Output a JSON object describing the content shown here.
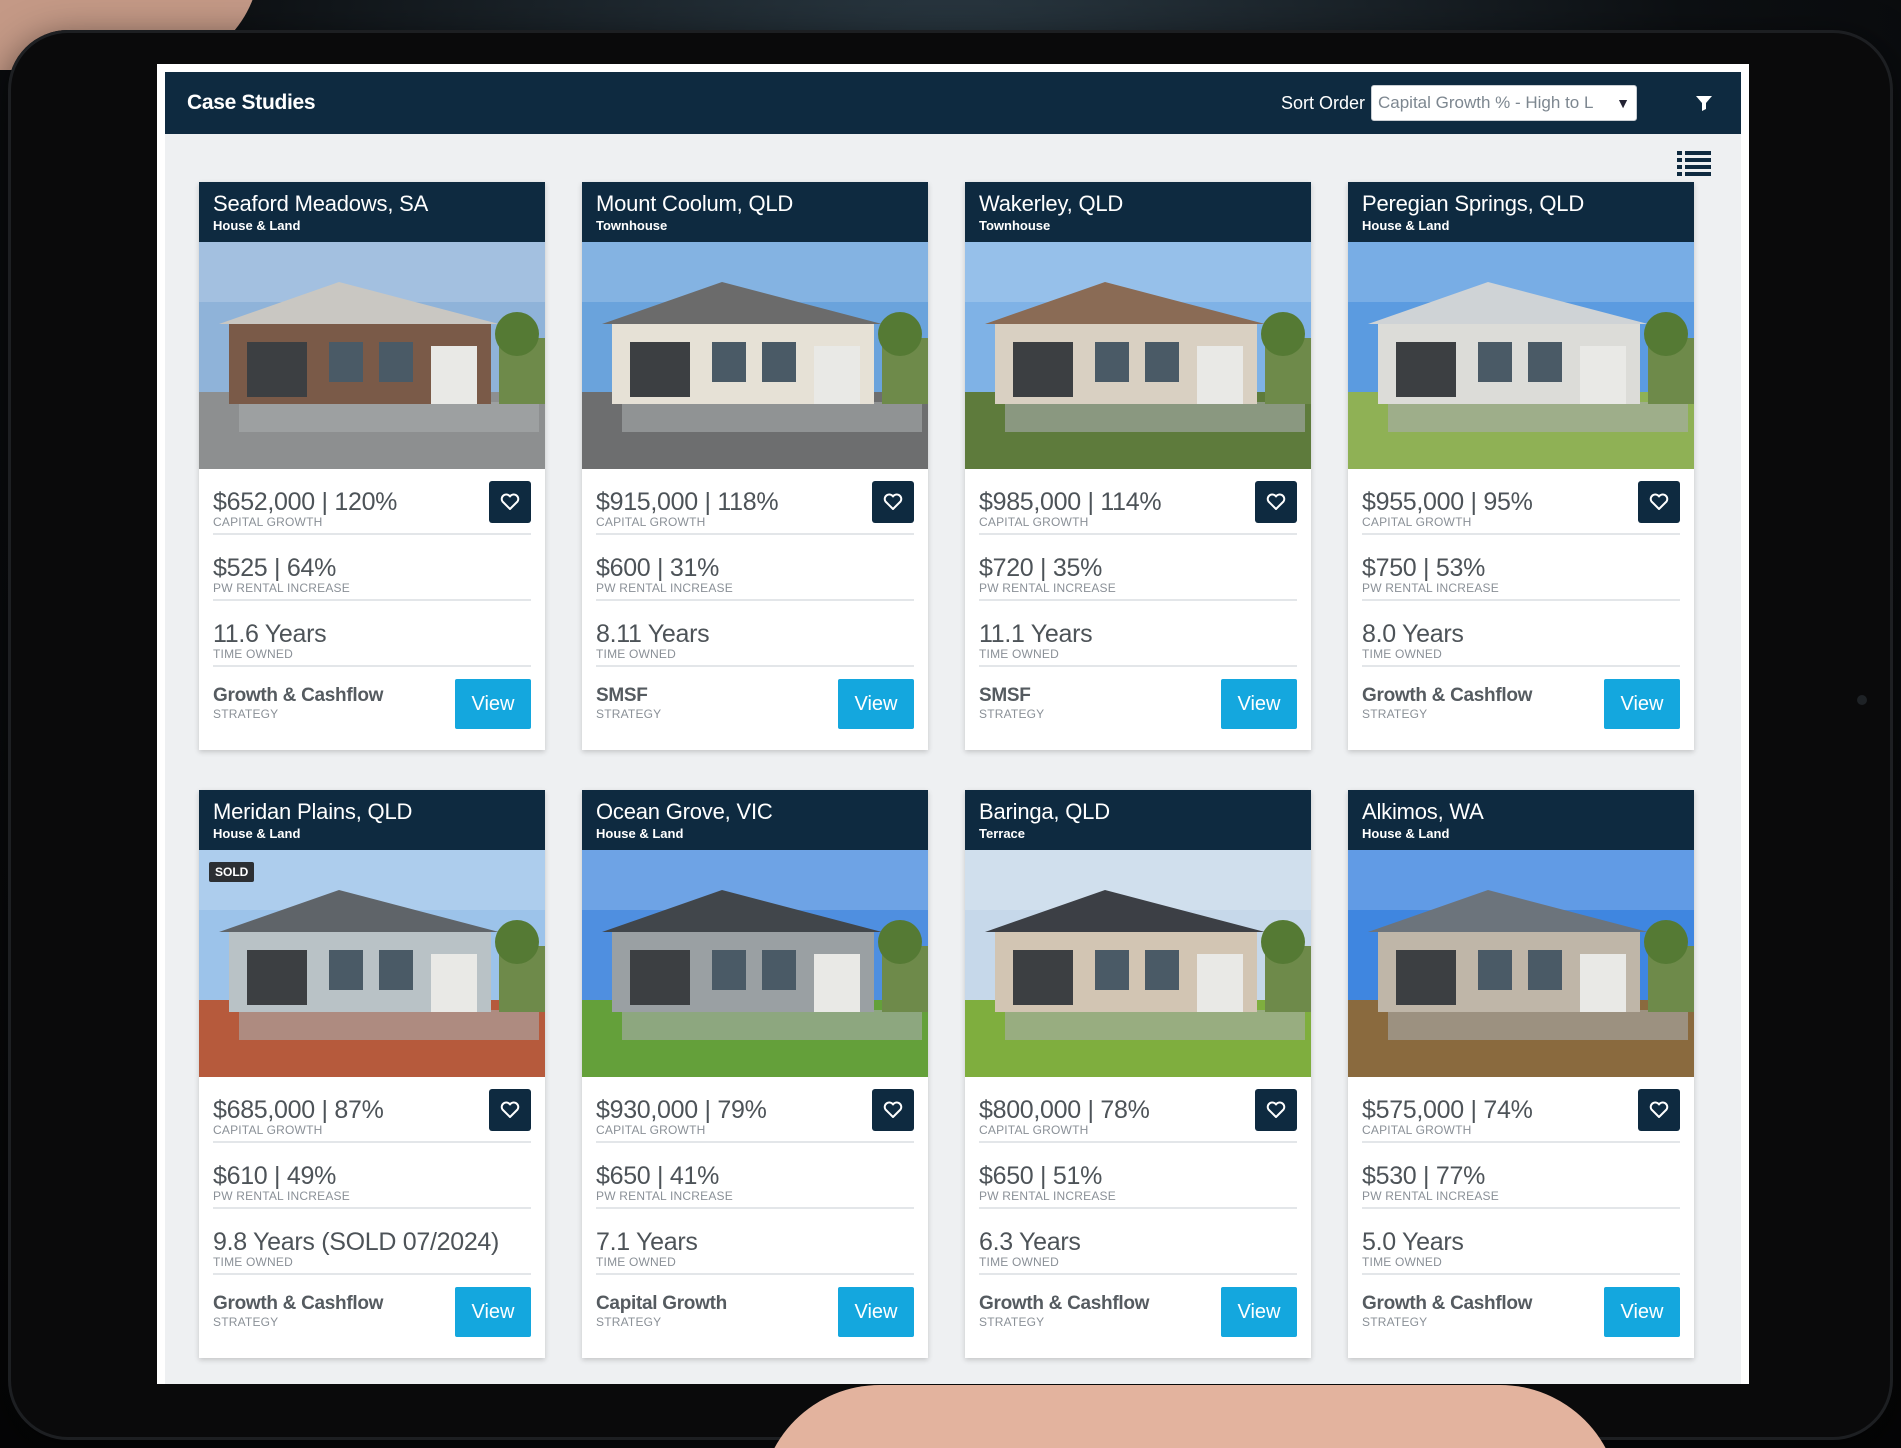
{
  "app": {
    "title": "Case Studies",
    "sort_label": "Sort Order",
    "sort_value": "Capital Growth % - High to L",
    "filter_icon": "filter-icon",
    "list_icon": "list-view-icon"
  },
  "labels": {
    "capital_growth": "CAPITAL GROWTH",
    "rental": "PW RENTAL INCREASE",
    "time": "TIME OWNED",
    "strategy": "STRATEGY",
    "view": "View",
    "sold": "SOLD"
  },
  "colors": {
    "header_navy": "#0e2a40",
    "view_blue": "#14a7de"
  },
  "cards": [
    {
      "location": "Seaford Meadows, SA",
      "type": "House & Land",
      "capital": "$652,000 | 120%",
      "rental": "$525 | 64%",
      "time": "11.6 Years",
      "strategy": "Growth & Cashflow",
      "sold": false
    },
    {
      "location": "Mount Coolum, QLD",
      "type": "Townhouse",
      "capital": "$915,000 | 118%",
      "rental": "$600 | 31%",
      "time": "8.11 Years",
      "strategy": "SMSF",
      "sold": false
    },
    {
      "location": "Wakerley, QLD",
      "type": "Townhouse",
      "capital": "$985,000 | 114%",
      "rental": "$720 | 35%",
      "time": "11.1 Years",
      "strategy": "SMSF",
      "sold": false
    },
    {
      "location": "Peregian Springs, QLD",
      "type": "House & Land",
      "capital": "$955,000 | 95%",
      "rental": "$750 | 53%",
      "time": "8.0 Years",
      "strategy": "Growth & Cashflow",
      "sold": false
    },
    {
      "location": "Meridan Plains, QLD",
      "type": "House & Land",
      "capital": "$685,000 | 87%",
      "rental": "$610 | 49%",
      "time": "9.8 Years (SOLD 07/2024)",
      "strategy": "Growth & Cashflow",
      "sold": true
    },
    {
      "location": "Ocean Grove, VIC",
      "type": "House & Land",
      "capital": "$930,000 | 79%",
      "rental": "$650 | 41%",
      "time": "7.1 Years",
      "strategy": "Capital Growth",
      "sold": false
    },
    {
      "location": "Baringa, QLD",
      "type": "Terrace",
      "capital": "$800,000 | 78%",
      "rental": "$650 | 51%",
      "time": "6.3 Years",
      "strategy": "Growth & Cashflow",
      "sold": false
    },
    {
      "location": "Alkimos, WA",
      "type": "House & Land",
      "capital": "$575,000 | 74%",
      "rental": "$530 | 77%",
      "time": "5.0 Years",
      "strategy": "Growth & Cashflow",
      "sold": false
    }
  ]
}
